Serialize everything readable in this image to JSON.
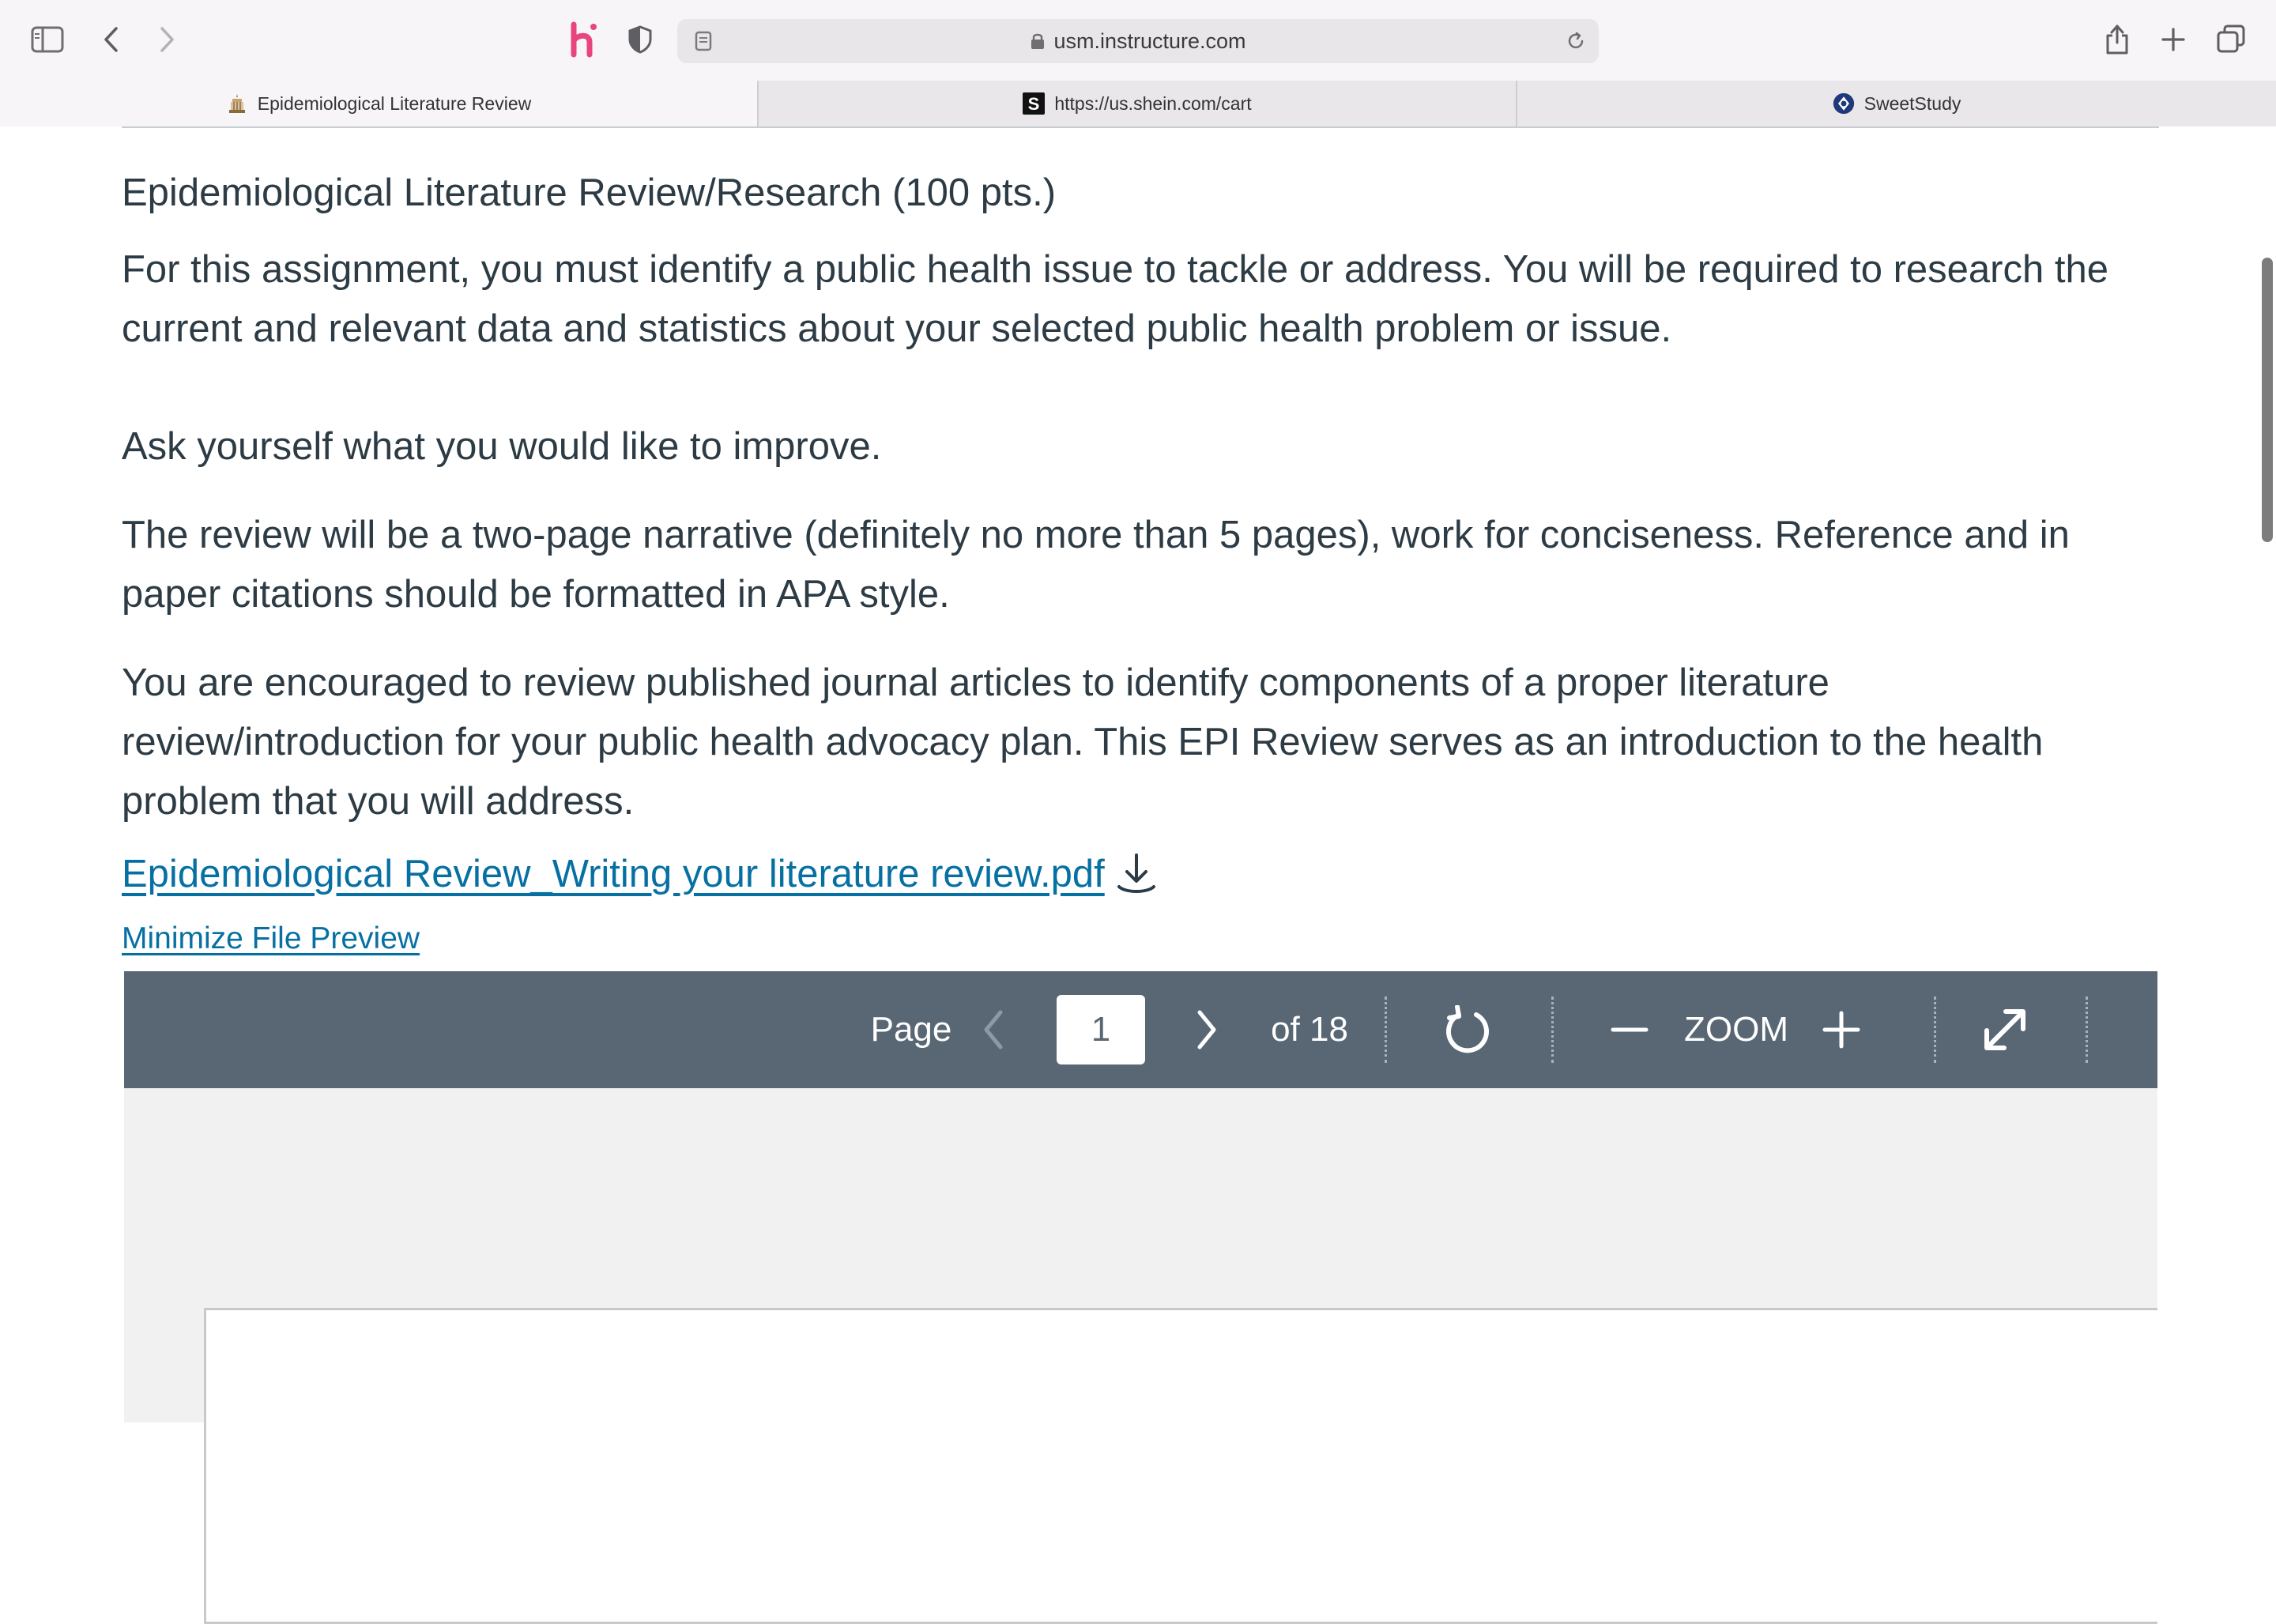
{
  "browser": {
    "url": "usm.instructure.com",
    "tabs": [
      {
        "label": "Epidemiological Literature Review",
        "favicon": "canvas-icon",
        "active": true
      },
      {
        "label": "https://us.shein.com/cart",
        "favicon": "shein-s-icon",
        "active": false
      },
      {
        "label": "SweetStudy",
        "favicon": "sweetstudy-icon",
        "active": false
      }
    ],
    "toolbar_icons": [
      "sidebar-icon",
      "back-icon",
      "forward-icon",
      "honey-extension-icon",
      "privacy-shield-icon",
      "reader-icon",
      "reload-icon",
      "share-icon",
      "new-tab-icon",
      "tab-overview-icon"
    ],
    "colors": {
      "honey": "#e8457d"
    }
  },
  "assignment": {
    "heading": "Epidemiological Literature Review/Research (100 pts.)",
    "paragraphs": [
      "For this assignment, you must identify a public health issue to tackle or address. You will be required to research the current and relevant data and statistics about your selected public health problem or issue.",
      "Ask yourself what you would like to improve.",
      "The review will be a two-page narrative (definitely no more than 5 pages), work for conciseness.  Reference and in paper citations should be formatted in APA style.",
      "You are encouraged to review published journal articles to identify components of a proper literature review/introduction for your public health advocacy plan.  This EPI Review serves as an introduction to the health problem that you will address."
    ],
    "file_link": "Epidemiological Review_Writing your literature review.pdf",
    "minimize_link": "Minimize File Preview",
    "link_color": "#0770a3"
  },
  "viewer": {
    "page_label": "Page",
    "current_page": "1",
    "total_label": "of 18",
    "zoom_label": "ZOOM",
    "bar_color": "#596774"
  }
}
